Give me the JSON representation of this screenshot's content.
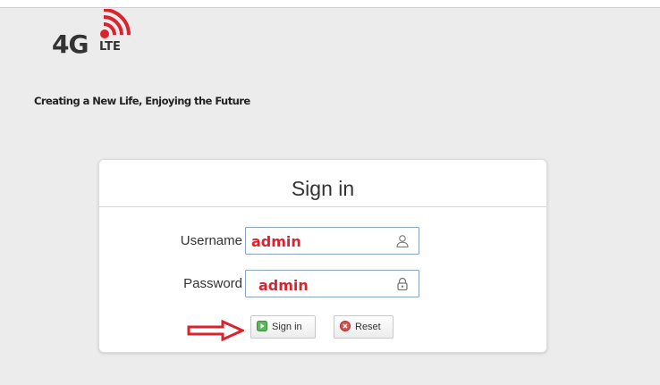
{
  "logo": {
    "main": "4G",
    "sub": "LTE"
  },
  "slogan": "Creating a New Life, Enjoying the Future",
  "login": {
    "title": "Sign in",
    "username_label": "Username",
    "username_value": "admin",
    "password_label": "Password",
    "password_value": "admin",
    "signin_label": "Sign in",
    "reset_label": "Reset"
  },
  "icons": {
    "signal": "wifi-signal-icon",
    "user": "user-icon",
    "lock": "lock-icon",
    "signin": "play-icon",
    "reset": "close-circle-icon",
    "arrow": "arrow-right-icon"
  },
  "colors": {
    "logo_red": "#d9232e",
    "value_red": "#d9232e",
    "arrow_red": "#d9232e"
  }
}
